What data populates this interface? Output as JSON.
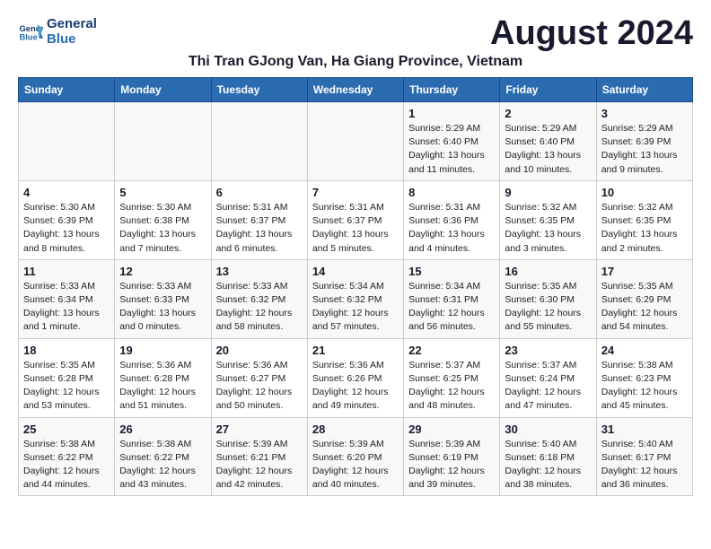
{
  "header": {
    "logo_line1": "General",
    "logo_line2": "Blue",
    "month_title": "August 2024",
    "location": "Thi Tran GJong Van, Ha Giang Province, Vietnam"
  },
  "weekdays": [
    "Sunday",
    "Monday",
    "Tuesday",
    "Wednesday",
    "Thursday",
    "Friday",
    "Saturday"
  ],
  "weeks": [
    [
      {
        "day": "",
        "info": ""
      },
      {
        "day": "",
        "info": ""
      },
      {
        "day": "",
        "info": ""
      },
      {
        "day": "",
        "info": ""
      },
      {
        "day": "1",
        "info": "Sunrise: 5:29 AM\nSunset: 6:40 PM\nDaylight: 13 hours\nand 11 minutes."
      },
      {
        "day": "2",
        "info": "Sunrise: 5:29 AM\nSunset: 6:40 PM\nDaylight: 13 hours\nand 10 minutes."
      },
      {
        "day": "3",
        "info": "Sunrise: 5:29 AM\nSunset: 6:39 PM\nDaylight: 13 hours\nand 9 minutes."
      }
    ],
    [
      {
        "day": "4",
        "info": "Sunrise: 5:30 AM\nSunset: 6:39 PM\nDaylight: 13 hours\nand 8 minutes."
      },
      {
        "day": "5",
        "info": "Sunrise: 5:30 AM\nSunset: 6:38 PM\nDaylight: 13 hours\nand 7 minutes."
      },
      {
        "day": "6",
        "info": "Sunrise: 5:31 AM\nSunset: 6:37 PM\nDaylight: 13 hours\nand 6 minutes."
      },
      {
        "day": "7",
        "info": "Sunrise: 5:31 AM\nSunset: 6:37 PM\nDaylight: 13 hours\nand 5 minutes."
      },
      {
        "day": "8",
        "info": "Sunrise: 5:31 AM\nSunset: 6:36 PM\nDaylight: 13 hours\nand 4 minutes."
      },
      {
        "day": "9",
        "info": "Sunrise: 5:32 AM\nSunset: 6:35 PM\nDaylight: 13 hours\nand 3 minutes."
      },
      {
        "day": "10",
        "info": "Sunrise: 5:32 AM\nSunset: 6:35 PM\nDaylight: 13 hours\nand 2 minutes."
      }
    ],
    [
      {
        "day": "11",
        "info": "Sunrise: 5:33 AM\nSunset: 6:34 PM\nDaylight: 13 hours\nand 1 minute."
      },
      {
        "day": "12",
        "info": "Sunrise: 5:33 AM\nSunset: 6:33 PM\nDaylight: 13 hours\nand 0 minutes."
      },
      {
        "day": "13",
        "info": "Sunrise: 5:33 AM\nSunset: 6:32 PM\nDaylight: 12 hours\nand 58 minutes."
      },
      {
        "day": "14",
        "info": "Sunrise: 5:34 AM\nSunset: 6:32 PM\nDaylight: 12 hours\nand 57 minutes."
      },
      {
        "day": "15",
        "info": "Sunrise: 5:34 AM\nSunset: 6:31 PM\nDaylight: 12 hours\nand 56 minutes."
      },
      {
        "day": "16",
        "info": "Sunrise: 5:35 AM\nSunset: 6:30 PM\nDaylight: 12 hours\nand 55 minutes."
      },
      {
        "day": "17",
        "info": "Sunrise: 5:35 AM\nSunset: 6:29 PM\nDaylight: 12 hours\nand 54 minutes."
      }
    ],
    [
      {
        "day": "18",
        "info": "Sunrise: 5:35 AM\nSunset: 6:28 PM\nDaylight: 12 hours\nand 53 minutes."
      },
      {
        "day": "19",
        "info": "Sunrise: 5:36 AM\nSunset: 6:28 PM\nDaylight: 12 hours\nand 51 minutes."
      },
      {
        "day": "20",
        "info": "Sunrise: 5:36 AM\nSunset: 6:27 PM\nDaylight: 12 hours\nand 50 minutes."
      },
      {
        "day": "21",
        "info": "Sunrise: 5:36 AM\nSunset: 6:26 PM\nDaylight: 12 hours\nand 49 minutes."
      },
      {
        "day": "22",
        "info": "Sunrise: 5:37 AM\nSunset: 6:25 PM\nDaylight: 12 hours\nand 48 minutes."
      },
      {
        "day": "23",
        "info": "Sunrise: 5:37 AM\nSunset: 6:24 PM\nDaylight: 12 hours\nand 47 minutes."
      },
      {
        "day": "24",
        "info": "Sunrise: 5:38 AM\nSunset: 6:23 PM\nDaylight: 12 hours\nand 45 minutes."
      }
    ],
    [
      {
        "day": "25",
        "info": "Sunrise: 5:38 AM\nSunset: 6:22 PM\nDaylight: 12 hours\nand 44 minutes."
      },
      {
        "day": "26",
        "info": "Sunrise: 5:38 AM\nSunset: 6:22 PM\nDaylight: 12 hours\nand 43 minutes."
      },
      {
        "day": "27",
        "info": "Sunrise: 5:39 AM\nSunset: 6:21 PM\nDaylight: 12 hours\nand 42 minutes."
      },
      {
        "day": "28",
        "info": "Sunrise: 5:39 AM\nSunset: 6:20 PM\nDaylight: 12 hours\nand 40 minutes."
      },
      {
        "day": "29",
        "info": "Sunrise: 5:39 AM\nSunset: 6:19 PM\nDaylight: 12 hours\nand 39 minutes."
      },
      {
        "day": "30",
        "info": "Sunrise: 5:40 AM\nSunset: 6:18 PM\nDaylight: 12 hours\nand 38 minutes."
      },
      {
        "day": "31",
        "info": "Sunrise: 5:40 AM\nSunset: 6:17 PM\nDaylight: 12 hours\nand 36 minutes."
      }
    ]
  ]
}
